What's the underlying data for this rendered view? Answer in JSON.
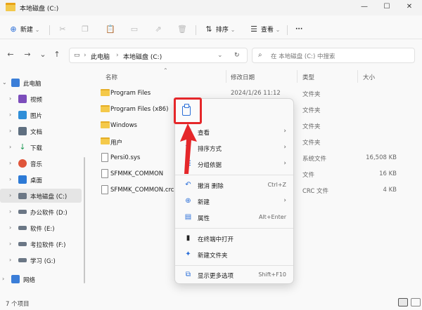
{
  "window": {
    "title": "本地磁盘 (C:)",
    "minimize": "—",
    "maximize": "☐",
    "close": "✕"
  },
  "toolbar": {
    "new_label": "新建",
    "sort_label": "排序",
    "view_label": "查看",
    "more_label": "···"
  },
  "nav": {
    "back": "←",
    "forward": "→",
    "dropdown": "⌄",
    "up": "↑",
    "breadcrumb": [
      "此电脑",
      "本地磁盘 (C:)"
    ],
    "search_placeholder": "在 本地磁盘 (C:) 中搜索"
  },
  "sidebar": {
    "items": [
      {
        "label": "此电脑",
        "color": "#3b7ed8"
      },
      {
        "label": "视频",
        "color": "#7c4dbb"
      },
      {
        "label": "图片",
        "color": "#2f8ed8"
      },
      {
        "label": "文档",
        "color": "#5f6f80"
      },
      {
        "label": "下载",
        "color": "#1f9a55"
      },
      {
        "label": "音乐",
        "color": "#e0553a"
      },
      {
        "label": "桌面",
        "color": "#2d7ad6"
      },
      {
        "label": "本地磁盘 (C:)",
        "color": "#6b7785"
      },
      {
        "label": "办公软件 (D:)",
        "color": "#6b7785"
      },
      {
        "label": "软件 (E:)",
        "color": "#6b7785"
      },
      {
        "label": "考拉软件 (F:)",
        "color": "#6b7785"
      },
      {
        "label": "学习 (G:)",
        "color": "#6b7785"
      },
      {
        "label": "网络",
        "color": "#3b7ed8"
      }
    ]
  },
  "columns": {
    "name": "名称",
    "date": "修改日期",
    "type": "类型",
    "size": "大小"
  },
  "files": [
    {
      "name": "Program Files",
      "date": "2024/1/26 11:12",
      "type": "文件夹",
      "size": "",
      "kind": "folder"
    },
    {
      "name": "Program Files (x86)",
      "date": "",
      "type": "文件夹",
      "size": "",
      "kind": "folder"
    },
    {
      "name": "Windows",
      "date": "",
      "type": "文件夹",
      "size": "",
      "kind": "folder"
    },
    {
      "name": "用户",
      "date": "",
      "type": "文件夹",
      "size": "",
      "kind": "folder"
    },
    {
      "name": "Persi0.sys",
      "date": "",
      "type": "系统文件",
      "size": "16,508 KB",
      "kind": "file"
    },
    {
      "name": "SFMMK_COMMON",
      "date": "",
      "type": "文件",
      "size": "16 KB",
      "kind": "file"
    },
    {
      "name": "SFMMK_COMMON.crc",
      "date": "",
      "type": "CRC 文件",
      "size": "4 KB",
      "kind": "file"
    }
  ],
  "status": {
    "count": "7 个项目"
  },
  "context_menu": {
    "items": [
      {
        "label": "查看",
        "key": "",
        "arrow": "›",
        "icon": "▦"
      },
      {
        "label": "排序方式",
        "key": "",
        "arrow": "›",
        "icon": "⇅"
      },
      {
        "label": "分组依据",
        "key": "",
        "arrow": "›",
        "icon": "☰"
      },
      {
        "label": "撤消 删除",
        "key": "Ctrl+Z",
        "arrow": "",
        "icon": "↶"
      },
      {
        "label": "新建",
        "key": "",
        "arrow": "›",
        "icon": "⊕"
      },
      {
        "label": "属性",
        "key": "Alt+Enter",
        "arrow": "",
        "icon": "▤"
      },
      {
        "label": "在终端中打开",
        "key": "",
        "arrow": "",
        "icon": "▮"
      },
      {
        "label": "新建文件夹",
        "key": "",
        "arrow": "",
        "icon": "✦"
      },
      {
        "label": "显示更多选项",
        "key": "Shift+F10",
        "arrow": "",
        "icon": "⧉"
      }
    ]
  },
  "colors": {
    "accent": "#2a6ed8",
    "highlight": "#e5272a"
  }
}
